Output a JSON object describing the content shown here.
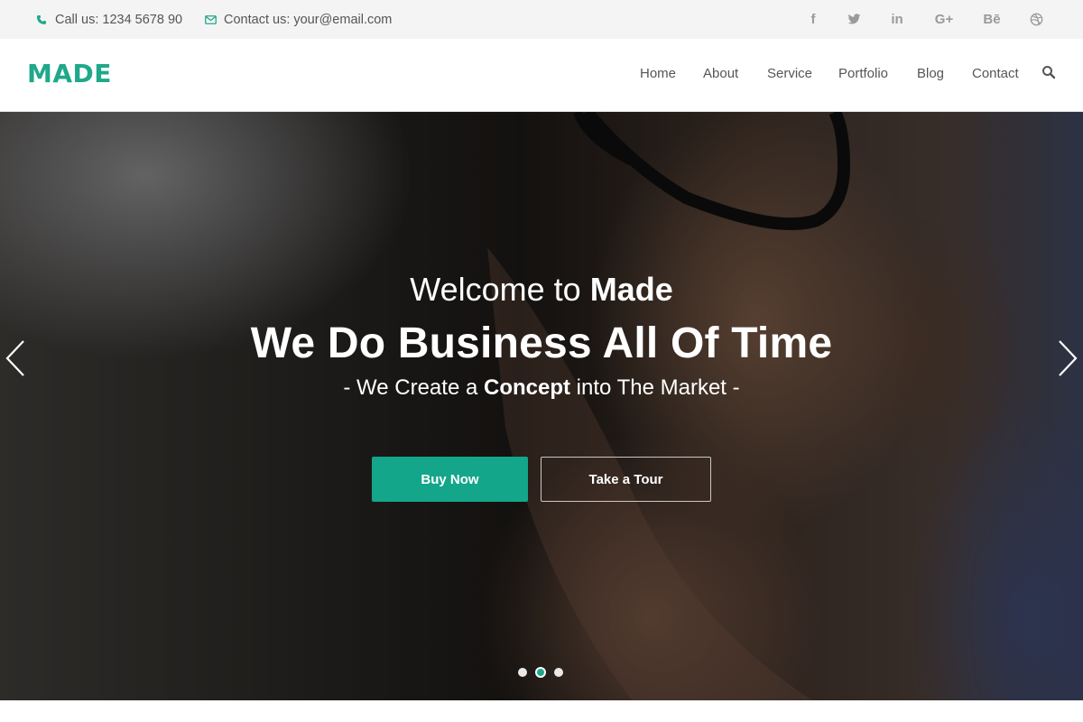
{
  "topbar": {
    "phone_label": "Call us: 1234 5678 90",
    "email_label": "Contact us: your@email.com",
    "social": [
      {
        "icon": "facebook-icon",
        "glyph": "f"
      },
      {
        "icon": "twitter-icon",
        "glyph": "t"
      },
      {
        "icon": "linkedin-icon",
        "glyph": "in"
      },
      {
        "icon": "google-plus-icon",
        "glyph": "G+"
      },
      {
        "icon": "behance-icon",
        "glyph": "Bē"
      },
      {
        "icon": "dribbble-icon",
        "glyph": "◍"
      }
    ]
  },
  "header": {
    "logo": "MADE",
    "nav": [
      {
        "label": "Home"
      },
      {
        "label": "About"
      },
      {
        "label": "Service"
      },
      {
        "label": "Portfolio"
      },
      {
        "label": "Blog"
      },
      {
        "label": "Contact"
      }
    ],
    "search_icon": "search-icon"
  },
  "hero": {
    "welcome_prefix": "Welcome to ",
    "welcome_brand": "Made",
    "title": "We Do Business All Of Time",
    "subtitle_prefix": "- We Create a ",
    "subtitle_bold": "Concept",
    "subtitle_suffix": " into The Market -",
    "primary_button": "Buy Now",
    "secondary_button": "Take a Tour",
    "slides_total": 3,
    "active_slide": 2
  },
  "colors": {
    "accent": "#14a68a",
    "logo": "#1fa88a",
    "topbar_bg": "#f4f4f4"
  }
}
